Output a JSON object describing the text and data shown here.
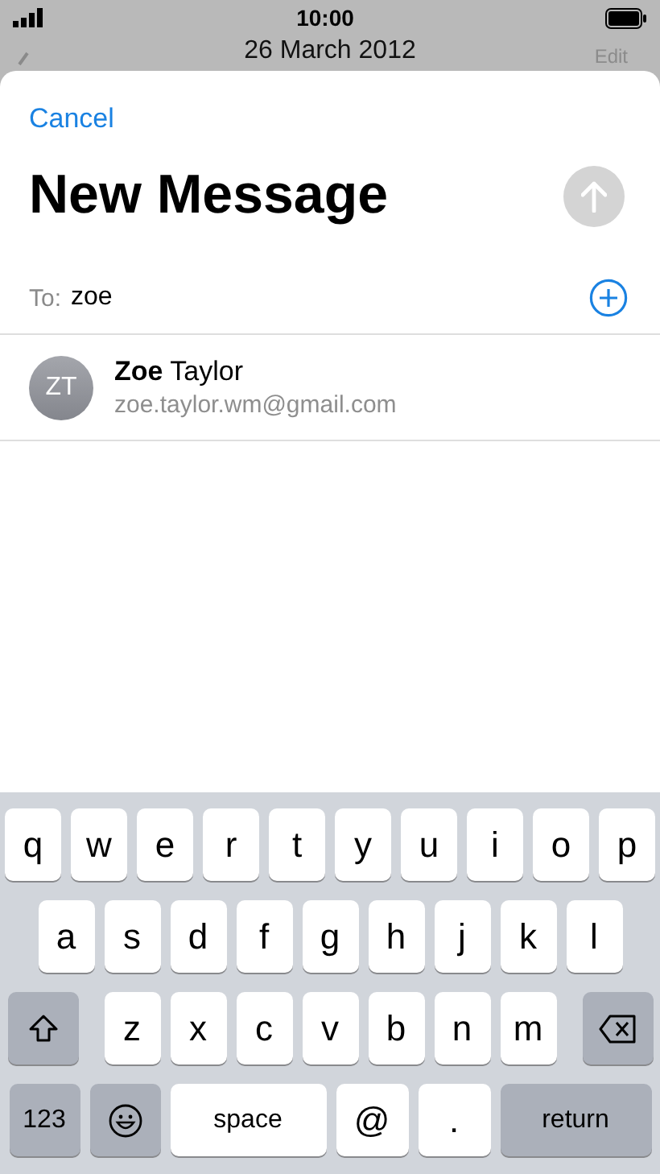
{
  "status_bar": {
    "time": "10:00"
  },
  "background_nav": {
    "title": "26 March 2012",
    "action": "Edit"
  },
  "compose": {
    "cancel": "Cancel",
    "title": "New Message",
    "send_disabled": true,
    "to_label": "To:",
    "to_value": "zoe"
  },
  "suggestions": [
    {
      "initials": "ZT",
      "name": "**Zoe** Taylor",
      "email": "zoe.taylor.wm@gmail.com"
    }
  ],
  "keyboard": {
    "rows": [
      {
        "keys": [
          {
            "kind": "letter",
            "label": "q"
          },
          {
            "kind": "letter",
            "label": "w"
          },
          {
            "kind": "letter",
            "label": "e"
          },
          {
            "kind": "letter",
            "label": "r"
          },
          {
            "kind": "letter",
            "label": "t"
          },
          {
            "kind": "letter",
            "label": "y"
          },
          {
            "kind": "letter",
            "label": "u"
          },
          {
            "kind": "letter",
            "label": "i"
          },
          {
            "kind": "letter",
            "label": "o"
          },
          {
            "kind": "letter",
            "label": "p"
          }
        ]
      },
      {
        "keys": [
          {
            "kind": "letter",
            "label": "a"
          },
          {
            "kind": "letter",
            "label": "s"
          },
          {
            "kind": "letter",
            "label": "d"
          },
          {
            "kind": "letter",
            "label": "f"
          },
          {
            "kind": "letter",
            "label": "g"
          },
          {
            "kind": "letter",
            "label": "h"
          },
          {
            "kind": "letter",
            "label": "j"
          },
          {
            "kind": "letter",
            "label": "k"
          },
          {
            "kind": "letter",
            "label": "l"
          }
        ]
      },
      {
        "keys": [
          {
            "kind": "shift"
          },
          {
            "kind": "letter",
            "label": "z"
          },
          {
            "kind": "letter",
            "label": "x"
          },
          {
            "kind": "letter",
            "label": "c"
          },
          {
            "kind": "letter",
            "label": "v"
          },
          {
            "kind": "letter",
            "label": "b"
          },
          {
            "kind": "letter",
            "label": "n"
          },
          {
            "kind": "letter",
            "label": "m"
          },
          {
            "kind": "delete"
          }
        ]
      },
      {
        "keys": [
          {
            "kind": "mode",
            "label": "123"
          },
          {
            "kind": "emoji"
          },
          {
            "kind": "space",
            "label": "space"
          },
          {
            "kind": "letter",
            "label": "@"
          },
          {
            "kind": "letter",
            "label": "."
          },
          {
            "kind": "return",
            "label": "return"
          }
        ]
      }
    ]
  }
}
